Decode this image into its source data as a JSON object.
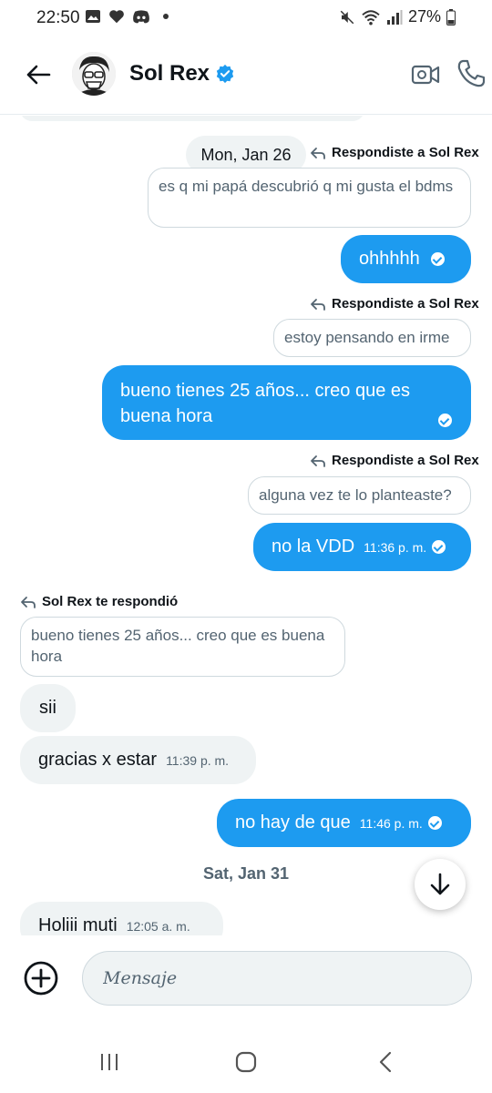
{
  "status_bar": {
    "time": "22:50",
    "battery": "27%",
    "icons": [
      "gallery-icon",
      "heart-icon",
      "discord-icon",
      "dot-icon",
      "mute-icon",
      "wifi-icon",
      "signal-icon",
      "battery-icon"
    ]
  },
  "header": {
    "contact_name": "Sol Rex",
    "verified": true,
    "accent_color": "#1d9bf0"
  },
  "messages": [
    {
      "type": "date",
      "text": "Mon, Jan 26"
    },
    {
      "type": "reply_label",
      "text": "Respondiste a Sol Rex"
    },
    {
      "type": "quote",
      "text": "es q mi papá descubrió q mi gusta el bdms"
    },
    {
      "type": "out",
      "text": "ohhhhh",
      "time": ""
    },
    {
      "type": "reply_label",
      "text": "Respondiste a Sol Rex"
    },
    {
      "type": "quote",
      "text": "estoy pensando en irme"
    },
    {
      "type": "out",
      "text": "bueno tienes 25 años... creo que es buena hora",
      "time": ""
    },
    {
      "type": "reply_label",
      "text": "Respondiste a Sol Rex"
    },
    {
      "type": "quote",
      "text": "alguna vez te lo planteaste?"
    },
    {
      "type": "out",
      "text": "no la VDD",
      "time": "11:36 p. m."
    },
    {
      "type": "reply_label_in",
      "text": "Sol Rex te respondió"
    },
    {
      "type": "quote_in",
      "text": "bueno tienes 25 años... creo que es buena hora"
    },
    {
      "type": "in",
      "text": "sii",
      "time": ""
    },
    {
      "type": "in",
      "text": "gracias x estar",
      "time": "11:39 p. m."
    },
    {
      "type": "out",
      "text": "no hay de que",
      "time": "11:46 p. m."
    },
    {
      "type": "date",
      "text": "Sat, Jan 31"
    },
    {
      "type": "in",
      "text": "Holiii muti",
      "time": "12:05 a. m."
    }
  ],
  "composer": {
    "placeholder": "Mensaje"
  }
}
